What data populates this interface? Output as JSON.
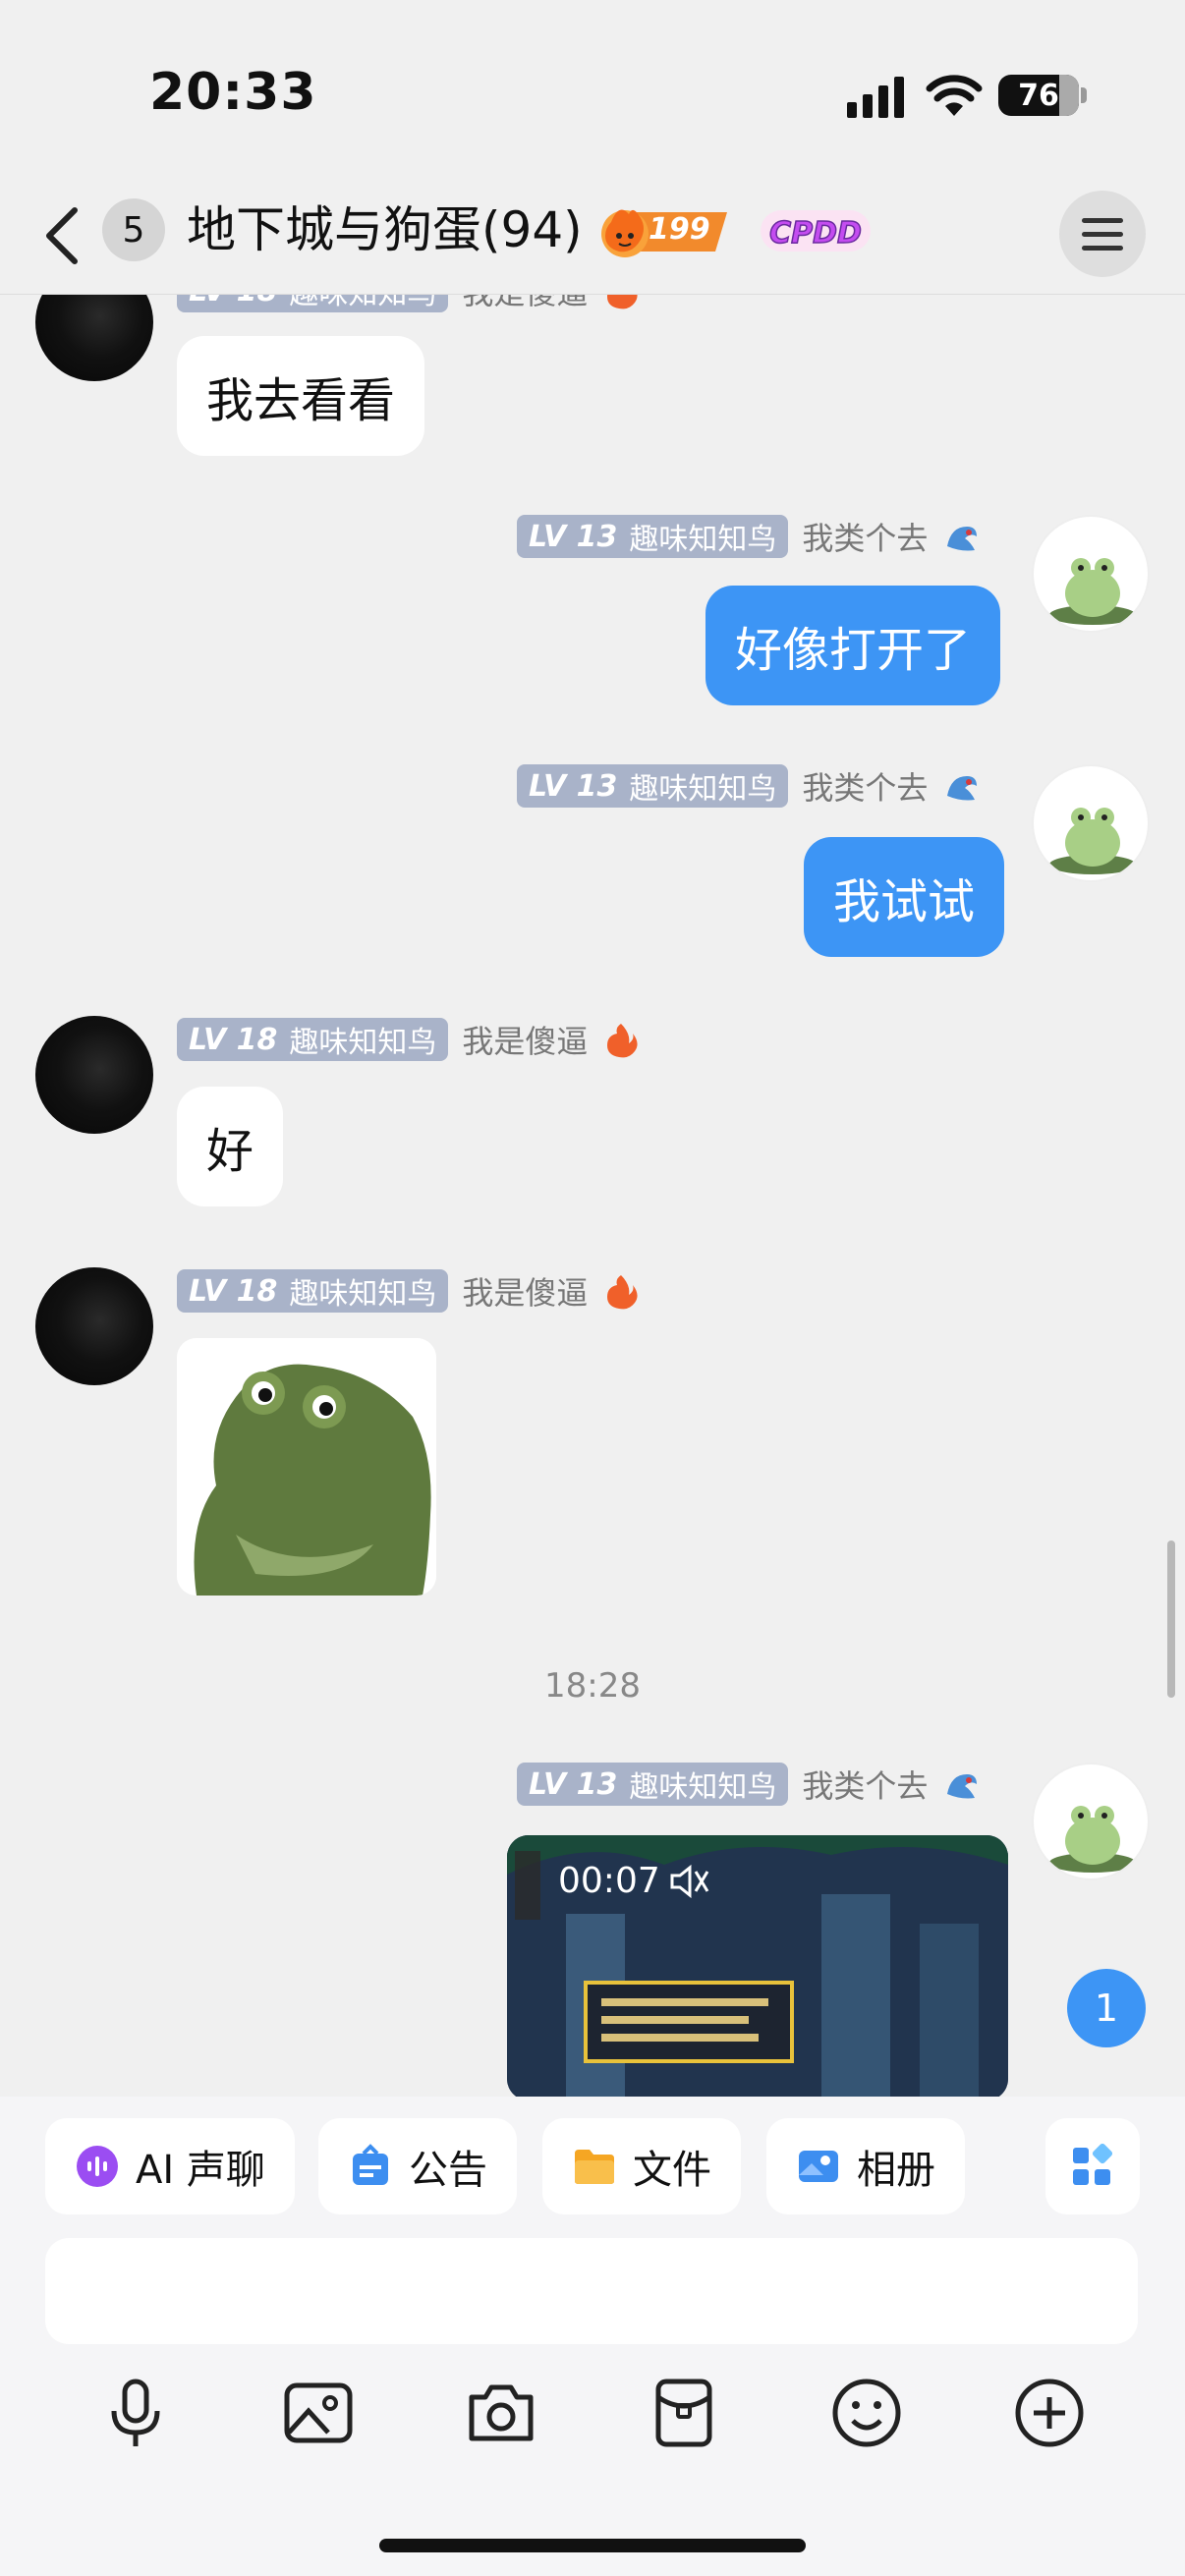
{
  "status": {
    "time": "20:33",
    "battery": "76"
  },
  "header": {
    "unread_count": "5",
    "title": "地下城与狗蛋(94)",
    "fire_count": "199",
    "badge_text": "CPDD"
  },
  "messages": [
    {
      "side": "in",
      "level": "LV 18",
      "nickname": "趣味知知鸟",
      "title": "我是傻逼",
      "text": "我去看看"
    },
    {
      "side": "out",
      "level": "LV 13",
      "nickname": "趣味知知鸟",
      "title": "我类个去",
      "text": "好像打开了"
    },
    {
      "side": "out",
      "level": "LV 13",
      "nickname": "趣味知知鸟",
      "title": "我类个去",
      "text": "我试试"
    },
    {
      "side": "in",
      "level": "LV 18",
      "nickname": "趣味知知鸟",
      "title": "我是傻逼",
      "text": "好"
    },
    {
      "side": "in",
      "level": "LV 18",
      "nickname": "趣味知知鸟",
      "title": "我是傻逼",
      "type": "sticker"
    },
    {
      "side": "out",
      "level": "LV 13",
      "nickname": "趣味知知鸟",
      "title": "我类个去",
      "type": "video",
      "duration": "00:07"
    }
  ],
  "timestamp": "18:28",
  "new_message_count": "1",
  "quick_actions": [
    {
      "label": "AI 声聊",
      "icon": "ai-voice-icon"
    },
    {
      "label": "公告",
      "icon": "announcement-icon"
    },
    {
      "label": "文件",
      "icon": "folder-icon"
    },
    {
      "label": "相册",
      "icon": "album-icon"
    }
  ],
  "input": {
    "placeholder": ""
  },
  "toolbar": [
    "microphone-icon",
    "image-icon",
    "camera-icon",
    "red-packet-icon",
    "emoji-icon",
    "plus-icon"
  ],
  "colors": {
    "accent": "#3d95f5",
    "level_badge": "#a9b3c9",
    "background": "#f0f0f0"
  }
}
